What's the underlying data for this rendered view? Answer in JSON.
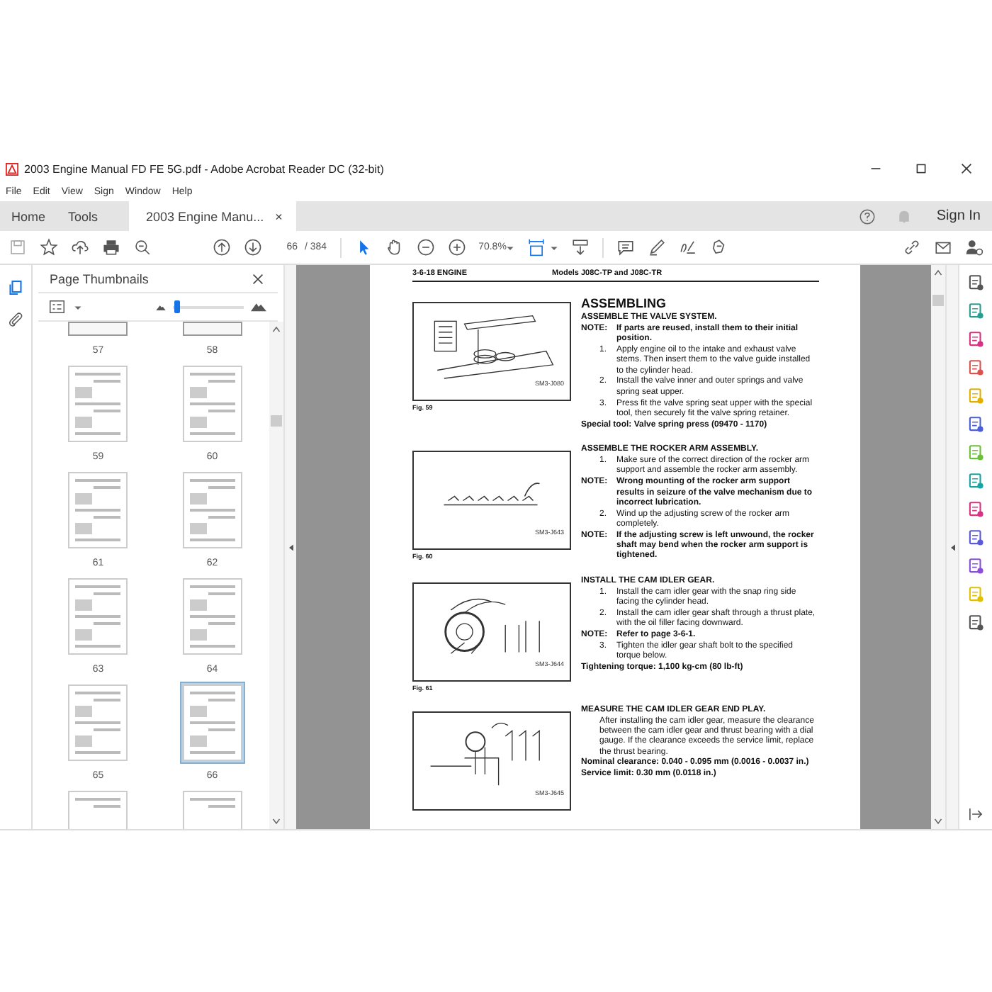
{
  "window": {
    "title": "2003 Engine Manual FD FE 5G.pdf - Adobe Acrobat Reader DC (32-bit)"
  },
  "menu": [
    "File",
    "Edit",
    "View",
    "Sign",
    "Window",
    "Help"
  ],
  "tabs": [
    {
      "label": "Home",
      "selected": false
    },
    {
      "label": "Tools",
      "selected": false
    },
    {
      "label": "2003 Engine Manu...",
      "selected": true,
      "close": "×"
    }
  ],
  "account": {
    "sign_in": "Sign In"
  },
  "toolbar": {
    "page": "66",
    "page_total": "/ 384",
    "zoom": "70.8%"
  },
  "thumbnails": {
    "title": "Page Thumbnails",
    "size_slider": {
      "level": 0.05
    },
    "pages": [
      {
        "label": "57",
        "kind": "cut",
        "selected": false
      },
      {
        "label": "58",
        "kind": "cut",
        "selected": false
      },
      {
        "label": "59",
        "kind": "full",
        "selected": false
      },
      {
        "label": "60",
        "kind": "full",
        "selected": false
      },
      {
        "label": "61",
        "kind": "full",
        "selected": false
      },
      {
        "label": "62",
        "kind": "full",
        "selected": false
      },
      {
        "label": "63",
        "kind": "full",
        "selected": false
      },
      {
        "label": "64",
        "kind": "full",
        "selected": false
      },
      {
        "label": "65",
        "kind": "full",
        "selected": false
      },
      {
        "label": "66",
        "kind": "full",
        "selected": true
      }
    ]
  },
  "document": {
    "header_left": "3-6-18 ENGINE",
    "header_right": "Models J08C-TP and J08C-TR",
    "sections": [
      {
        "figure": {
          "kind": "valve",
          "code": "SM3-J080",
          "caption": "Fig. 59"
        },
        "blocks": [
          {
            "kind": "heading",
            "text": "ASSEMBLING"
          },
          {
            "kind": "subheading",
            "text": "ASSEMBLE THE VALVE SYSTEM."
          },
          {
            "kind": "note",
            "label": "NOTE:",
            "text": "If parts are reused, install them to their initial position."
          },
          {
            "kind": "step",
            "label": "1.",
            "text": "Apply engine oil to the intake and exhaust valve stems. Then insert them to the valve guide installed to the cylinder head."
          },
          {
            "kind": "step",
            "label": "2.",
            "text": "Install the valve inner and outer springs and valve spring seat upper."
          },
          {
            "kind": "step",
            "label": "3.",
            "text": "Press fit the valve spring seat upper with the special tool, then securely fit the valve spring retainer."
          },
          {
            "kind": "spec",
            "text": "Special tool:  Valve spring press (09470 - 1170)"
          }
        ]
      },
      {
        "figure": {
          "kind": "rocker",
          "code": "SM3-J643",
          "caption": "Fig. 60"
        },
        "blocks": [
          {
            "kind": "subheading",
            "text": "ASSEMBLE THE ROCKER ARM ASSEMBLY."
          },
          {
            "kind": "step",
            "label": "1.",
            "text": "Make sure of the correct direction of the rocker arm support and assemble the rocker arm assembly."
          },
          {
            "kind": "note",
            "label": "NOTE:",
            "text": "Wrong mounting of the rocker arm support results in seizure of the valve mechanism due to incorrect lubrication."
          },
          {
            "kind": "step",
            "label": "2.",
            "text": "Wind up the adjusting screw of the rocker arm completely."
          },
          {
            "kind": "note",
            "label": "NOTE:",
            "text": "If the adjusting screw is left unwound, the rocker shaft may bend when the rocker arm support is tightened."
          }
        ]
      },
      {
        "figure": {
          "kind": "gear",
          "code": "SM3-J644",
          "caption": "Fig. 61"
        },
        "blocks": [
          {
            "kind": "subheading",
            "text": "INSTALL THE CAM IDLER GEAR."
          },
          {
            "kind": "step",
            "label": "1.",
            "text": "Install the cam idler gear with the snap ring side facing the cylinder head."
          },
          {
            "kind": "step",
            "label": "2.",
            "text": "Install the cam idler gear shaft through a thrust plate, with the oil filler facing downward."
          },
          {
            "kind": "note",
            "label": "NOTE:",
            "text": "Refer to page 3-6-1."
          },
          {
            "kind": "step",
            "label": "3.",
            "text": "Tighten the idler gear shaft bolt to the specified torque below."
          },
          {
            "kind": "spec",
            "text": "Tightening torque:  1,100 kg-cm (80 lb-ft)"
          }
        ]
      },
      {
        "figure": {
          "kind": "gauge",
          "code": "SM3-J645"
        },
        "blocks": [
          {
            "kind": "subheading",
            "text": "MEASURE THE CAM IDLER GEAR END PLAY."
          },
          {
            "kind": "para",
            "text": "After installing the cam idler gear, measure the clearance between the cam idler gear and thrust bearing with a dial gauge. If the clearance exceeds the service limit, replace the thrust bearing."
          },
          {
            "kind": "spec",
            "text": "Nominal clearance:  0.040 - 0.095 mm (0.0016 - 0.0037 in.)"
          },
          {
            "kind": "spec",
            "text": "Service limit:  0.30 mm (0.0118 in.)"
          }
        ]
      }
    ]
  }
}
